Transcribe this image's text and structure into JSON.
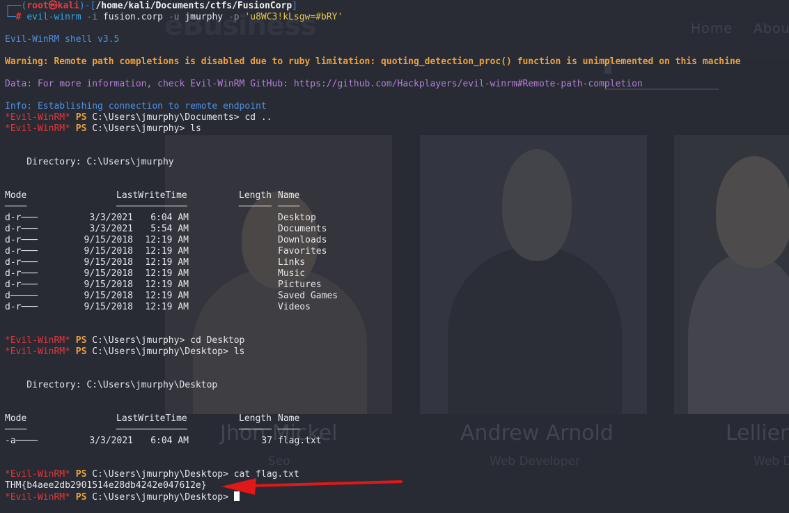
{
  "background_site": {
    "brand": "eBusiness",
    "nav": [
      "Home",
      "Abou"
    ],
    "team": [
      {
        "name": "Jhon Mickel",
        "role": "Seo"
      },
      {
        "name": "Andrew Arnold",
        "role": "Web Developer"
      },
      {
        "name": "Lellien",
        "role": "Web D"
      }
    ]
  },
  "terminal": {
    "prompt": {
      "user": "root",
      "host": "kali",
      "cwd": "/home/kali/Documents/ctfs/FusionCorp",
      "cmd_name": "evil-winrm",
      "arg_i_flag": "-i",
      "arg_i_value": "fusion.corp",
      "arg_u_flag": "-u",
      "arg_u_value": "jmurphy",
      "arg_p_flag": "-p",
      "arg_p_value": "'u8WC3!kLsgw=#bRY'"
    },
    "shell_banner": "Evil-WinRM shell v3.5",
    "warning": "Warning: Remote path completions is disabled due to ruby limitation: quoting_detection_proc() function is unimplemented on this machine",
    "data_line": "Data: For more information, check Evil-WinRM GitHub: https://github.com/Hackplayers/evil-winrm#Remote-path-completion",
    "info_line": "Info: Establishing connection to remote endpoint",
    "ps_tag": "*Evil-WinRM*",
    "ps_word": "PS",
    "commands": [
      "C:\\Users\\jmurphy\\Documents> cd ..",
      "C:\\Users\\jmurphy> ls",
      "C:\\Users\\jmurphy> cd Desktop",
      "C:\\Users\\jmurphy\\Desktop> ls",
      "C:\\Users\\jmurphy\\Desktop> cat flag.txt",
      "C:\\Users\\jmurphy\\Desktop> "
    ],
    "listing1": {
      "directory": "    Directory: C:\\Users\\jmurphy",
      "headers": {
        "mode": "Mode",
        "time": "LastWriteTime",
        "length": "Length",
        "name": "Name"
      },
      "underlines": {
        "mode": "────",
        "time": "─────────────",
        "length": "──────",
        "name": "────"
      },
      "rows": [
        {
          "mode": "d-r───",
          "date": "3/3/2021",
          "time": "6:04 AM",
          "length": "",
          "name": "Desktop"
        },
        {
          "mode": "d-r───",
          "date": "3/3/2021",
          "time": "5:54 AM",
          "length": "",
          "name": "Documents"
        },
        {
          "mode": "d-r───",
          "date": "9/15/2018",
          "time": "12:19 AM",
          "length": "",
          "name": "Downloads"
        },
        {
          "mode": "d-r───",
          "date": "9/15/2018",
          "time": "12:19 AM",
          "length": "",
          "name": "Favorites"
        },
        {
          "mode": "d-r───",
          "date": "9/15/2018",
          "time": "12:19 AM",
          "length": "",
          "name": "Links"
        },
        {
          "mode": "d-r───",
          "date": "9/15/2018",
          "time": "12:19 AM",
          "length": "",
          "name": "Music"
        },
        {
          "mode": "d-r───",
          "date": "9/15/2018",
          "time": "12:19 AM",
          "length": "",
          "name": "Pictures"
        },
        {
          "mode": "d─────",
          "date": "9/15/2018",
          "time": "12:19 AM",
          "length": "",
          "name": "Saved Games"
        },
        {
          "mode": "d-r───",
          "date": "9/15/2018",
          "time": "12:19 AM",
          "length": "",
          "name": "Videos"
        }
      ]
    },
    "listing2": {
      "directory": "    Directory: C:\\Users\\jmurphy\\Desktop",
      "headers": {
        "mode": "Mode",
        "time": "LastWriteTime",
        "length": "Length",
        "name": "Name"
      },
      "underlines": {
        "mode": "────",
        "time": "─────────────",
        "length": "──────",
        "name": "────"
      },
      "rows": [
        {
          "mode": "-a────",
          "date": "3/3/2021",
          "time": "6:04 AM",
          "length": "37",
          "name": "flag.txt"
        }
      ]
    },
    "flag_output": "THM{b4aee2db2901514e28db4242e047612e}"
  },
  "colors": {
    "terminal_bg": "#2b2f38",
    "prompt_frame": "#3f87e0",
    "root_red": "#ef3b3b",
    "warning_orange": "#f0a13a",
    "data_purple": "#b57fd6",
    "info_blue": "#4e8fe0",
    "evil_red": "#e5353b",
    "arrow_red": "#e01818"
  }
}
